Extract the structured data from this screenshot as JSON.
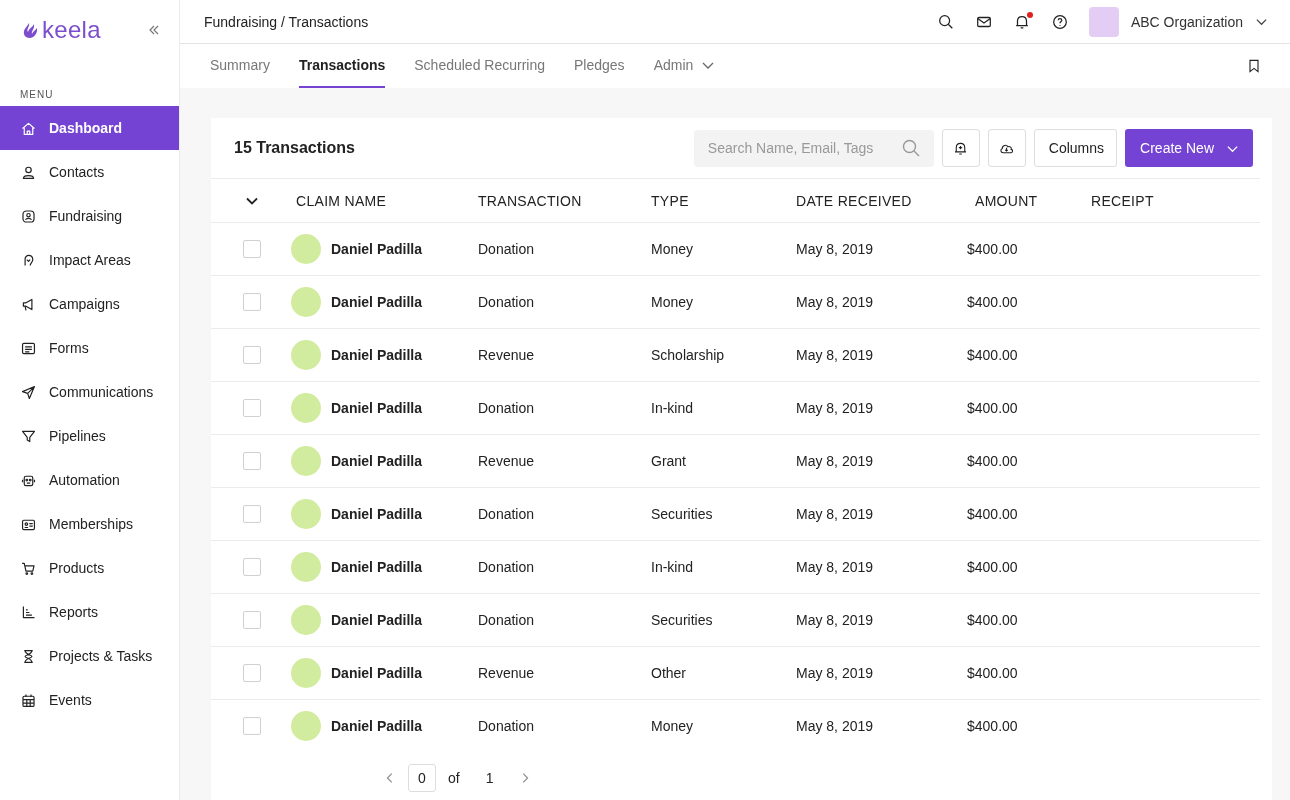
{
  "logo": {
    "text": "keela"
  },
  "sidebar": {
    "heading": "MENU",
    "items": [
      {
        "label": "Dashboard",
        "selected": true
      },
      {
        "label": "Contacts",
        "selected": false
      },
      {
        "label": "Fundraising",
        "selected": false
      },
      {
        "label": "Impact Areas",
        "selected": false
      },
      {
        "label": "Campaigns",
        "selected": false
      },
      {
        "label": "Forms",
        "selected": false
      },
      {
        "label": "Communications",
        "selected": false
      },
      {
        "label": "Pipelines",
        "selected": false
      },
      {
        "label": "Automation",
        "selected": false
      },
      {
        "label": "Memberships",
        "selected": false
      },
      {
        "label": "Products",
        "selected": false
      },
      {
        "label": "Reports",
        "selected": false
      },
      {
        "label": "Projects & Tasks",
        "selected": false
      },
      {
        "label": "Events",
        "selected": false
      }
    ]
  },
  "header": {
    "breadcrumb": "Fundraising / Transactions",
    "notifications_unread": true,
    "organization": "ABC Organization"
  },
  "tabs": [
    {
      "label": "Summary",
      "selected": false,
      "dropdown": false
    },
    {
      "label": "Transactions",
      "selected": true,
      "dropdown": false
    },
    {
      "label": "Scheduled Recurring",
      "selected": false,
      "dropdown": false
    },
    {
      "label": "Pledges",
      "selected": false,
      "dropdown": false
    },
    {
      "label": "Admin",
      "selected": false,
      "dropdown": true
    }
  ],
  "toolbar": {
    "count": "15 Transactions",
    "search": {
      "placeholder": "Search Name, Email, Tags"
    },
    "columns_button": "Columns",
    "create_button": "Create New"
  },
  "table": {
    "columns": [
      "CLAIM NAME",
      "TRANSACTION",
      "TYPE",
      "DATE RECEIVED",
      "AMOUNT",
      "RECEIPT"
    ],
    "rows": [
      {
        "checked": false,
        "name": "Daniel Padilla",
        "transaction": "Donation",
        "type": "Money",
        "date": "May 8, 2019",
        "amount": "$400.00"
      },
      {
        "checked": false,
        "name": "Daniel Padilla",
        "transaction": "Donation",
        "type": "Money",
        "date": "May 8, 2019",
        "amount": "$400.00"
      },
      {
        "checked": false,
        "name": "Daniel Padilla",
        "transaction": "Revenue",
        "type": "Scholarship",
        "date": "May 8, 2019",
        "amount": "$400.00"
      },
      {
        "checked": false,
        "name": "Daniel Padilla",
        "transaction": "Donation",
        "type": "In-kind",
        "date": "May 8, 2019",
        "amount": "$400.00"
      },
      {
        "checked": false,
        "name": "Daniel Padilla",
        "transaction": "Revenue",
        "type": "Grant",
        "date": "May 8, 2019",
        "amount": "$400.00"
      },
      {
        "checked": false,
        "name": "Daniel Padilla",
        "transaction": "Donation",
        "type": "Securities",
        "date": "May 8, 2019",
        "amount": "$400.00"
      },
      {
        "checked": false,
        "name": "Daniel Padilla",
        "transaction": "Donation",
        "type": "In-kind",
        "date": "May 8, 2019",
        "amount": "$400.00"
      },
      {
        "checked": false,
        "name": "Daniel Padilla",
        "transaction": "Donation",
        "type": "Securities",
        "date": "May 8, 2019",
        "amount": "$400.00"
      },
      {
        "checked": false,
        "name": "Daniel Padilla",
        "transaction": "Revenue",
        "type": "Other",
        "date": "May 8, 2019",
        "amount": "$400.00"
      },
      {
        "checked": false,
        "name": "Daniel Padilla",
        "transaction": "Donation",
        "type": "Money",
        "date": "May 8, 2019",
        "amount": "$400.00"
      }
    ]
  },
  "pagination": {
    "page": "0",
    "of": "of",
    "total": "1"
  }
}
